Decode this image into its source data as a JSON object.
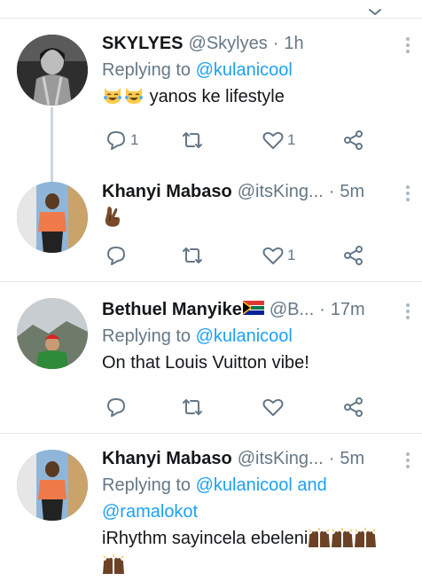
{
  "tweets": [
    {
      "name": "SKYLYES",
      "handle": "@Skylyes",
      "time": "1h",
      "reply_label": "Replying to",
      "reply_to": "@kulanicool",
      "text": "yanos ke lifestyle",
      "emoji": [
        "crying-laughing-cat-emoji",
        "crying-laughing-cat-emoji"
      ],
      "reply_count": "1",
      "retweet_count": "",
      "like_count": "1"
    },
    {
      "name": "Khanyi Mabaso",
      "handle": "@itsKing...",
      "time": "5m",
      "text": "",
      "emoji": [
        "crossed-fingers-emoji"
      ],
      "reply_count": "",
      "retweet_count": "",
      "like_count": "1"
    },
    {
      "name": "Bethuel Manyike",
      "flag": "south-africa-flag-emoji",
      "handle": "@B...",
      "time": "17m",
      "reply_label": "Replying to",
      "reply_to": "@kulanicool",
      "text": "On that Louis Vuitton vibe!",
      "reply_count": "",
      "retweet_count": "",
      "like_count": ""
    },
    {
      "name": "Khanyi Mabaso",
      "handle": "@itsKing...",
      "time": "5m",
      "reply_label": "Replying to",
      "reply_to": "@kulanicool and",
      "reply_to_2": "@ramalokot",
      "text": "iRhythm sayincela ebeleni",
      "emoji": [
        "raising-hands-emoji",
        "raising-hands-emoji",
        "raising-hands-emoji",
        "raising-hands-emoji",
        "raising-hands-emoji"
      ]
    }
  ],
  "separator": "·",
  "colors": {
    "link": "#1da1f2",
    "muted": "#657786",
    "divider": "#e1e8ed",
    "text": "#14171a"
  }
}
